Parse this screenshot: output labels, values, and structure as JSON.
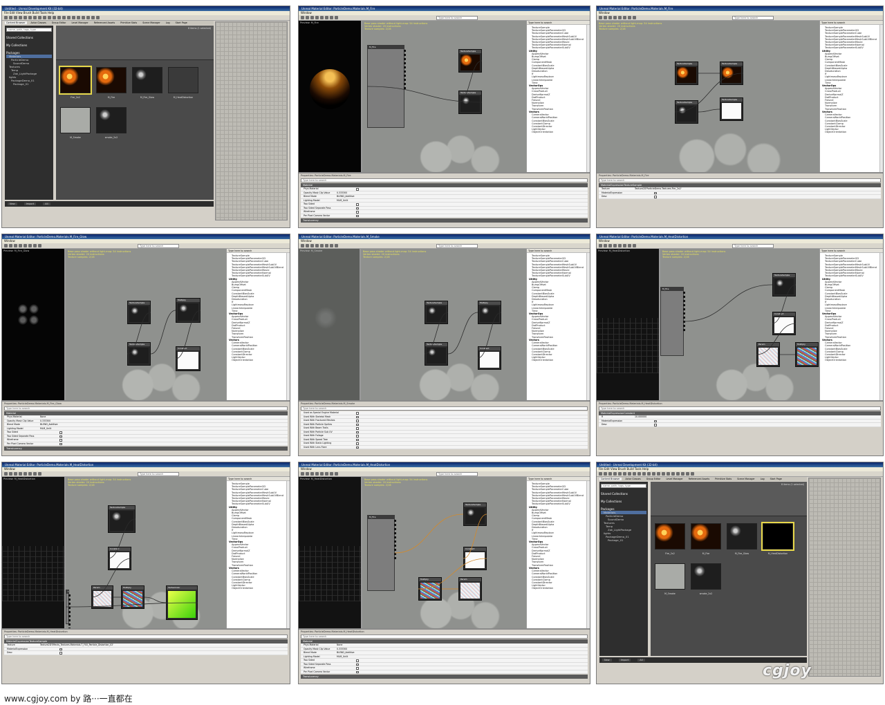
{
  "watermark": "www.cgjoy.com by 路···一直都在",
  "logo_text": "cgjoy",
  "panels": [
    {
      "kind": "content-browser",
      "title": "Untitled - Unreal Development Kit (32-bit)",
      "menu": "File  Edit  View  Brush  Build  Tools  Help",
      "tabs": [
        "Content Browser",
        "Actor Classes",
        "Group Editor",
        "Level Manager",
        "Referenced Assets",
        "Primitive Stats",
        "Scene Manager",
        "Log",
        "Start Page"
      ],
      "search_placeholder": "name, path, tags, type",
      "collections": [
        "Shared Collections",
        "My Collections",
        "Packages"
      ],
      "tree": [
        "Materials",
        "ParticleDemo",
        "SoundDemo",
        "Textures",
        "Temp",
        "Zak_LightPackage",
        "lights",
        "PackageDemo_01",
        "Package_01"
      ],
      "tiles": [
        "Fire_2x2",
        "M_Fire",
        "M_Fire_Glow",
        "M_HeatDistortion",
        "M_Smoke",
        "smoke_2x2"
      ],
      "status": "8 items (1 selected)",
      "footer": [
        "New",
        "Import",
        "All"
      ]
    },
    {
      "kind": "material-editor",
      "title": "Unreal Material Editor: ParticleDemo.Materials.M_Fire",
      "window_menu": "Window",
      "preview_label": "Preview: M_Fire",
      "search_placeholder": "Type here to search",
      "preview": "fire",
      "props_title": "Properties: ParticleDemo.Materials.M_Fire",
      "props_section": "Material",
      "props_rows": [
        [
          "Phys Material",
          ""
        ],
        [
          "Opacity Mask Clip Value",
          "0.333300"
        ],
        [
          "Blend Mode",
          "BLEND_Additive"
        ],
        [
          "Lighting Model",
          "MLM_Unlit"
        ],
        [
          "Two Sided",
          ""
        ],
        [
          "Two Sided Separate Pass",
          ""
        ],
        [
          "Wireframe",
          ""
        ],
        [
          "Per Pixel Camera Vector",
          ""
        ]
      ],
      "props_footer": "Translucency"
    },
    {
      "kind": "material-editor",
      "title": "Unreal Material Editor: ParticleDemo.Materials.M_Fire",
      "window_menu": "Window",
      "preview_label": "Preview: M_Fire",
      "search_placeholder": "Type here to search",
      "preview": "fire-small",
      "props_title": "Properties: ParticleDemo.Materials.M_Fire",
      "props_section": "MaterialExpressionTextureSample",
      "props_rows": [
        [
          "Texture",
          "Texture2D'ParticleDemo.Textures.Fire_2x2'"
        ],
        [
          "MaterialExpression",
          ""
        ],
        [
          "Desc",
          ""
        ]
      ],
      "props_footer": ""
    },
    {
      "kind": "material-editor",
      "title": "Unreal Material Editor: ParticleDemo.Materials.M_Fire_Glow",
      "window_menu": "Window",
      "preview_label": "Preview: M_Fire_Glow",
      "search_placeholder": "Type here to search",
      "preview": "smoke-dim",
      "props_title": "Properties: ParticleDemo.Materials.M_Fire_Glow",
      "props_section": "Material",
      "props_rows": [
        [
          "Phys Material",
          "None"
        ],
        [
          "Opacity Mask Clip Value",
          "0.333300"
        ],
        [
          "Blend Mode",
          "BLEND_Additive"
        ],
        [
          "Lighting Model",
          "MLM_Unlit"
        ],
        [
          "Two Sided",
          ""
        ],
        [
          "Two Sided Separate Pass",
          ""
        ],
        [
          "Wireframe",
          ""
        ],
        [
          "Per Pixel Camera Vector",
          ""
        ]
      ],
      "props_footer": "Translucency"
    },
    {
      "kind": "material-editor",
      "title": "Unreal Material Editor: ParticleDemo.Materials.M_Smoke",
      "window_menu": "Window",
      "preview_label": "Preview: M_Smoke",
      "search_placeholder": "Type here to search",
      "preview": "grey",
      "props_title": "Properties: ParticleDemo.Materials.M_Smoke",
      "props_section": "",
      "props_rows": [
        [
          "Used as Special Engine Material",
          ""
        ],
        [
          "Used With Skeletal Mesh",
          ""
        ],
        [
          "Used With Fractured Meshes",
          ""
        ],
        [
          "Used With Particle Sprites",
          ""
        ],
        [
          "Used With Beam Trails",
          ""
        ],
        [
          "Used With Particle Sub UV",
          ""
        ],
        [
          "Used With Foliage",
          ""
        ],
        [
          "Used With Speed Tree",
          ""
        ],
        [
          "Used With Static Lighting",
          ""
        ],
        [
          "Used With Lens Flare",
          ""
        ]
      ],
      "props_footer": ""
    },
    {
      "kind": "material-editor",
      "title": "Unreal Material Editor: ParticleDemo.Materials.M_HeatDistortion",
      "window_menu": "Window",
      "preview_label": "Preview: M_HeatDistortion",
      "search_placeholder": "Type here to search",
      "preview": "grid",
      "props_title": "Properties: ParticleDemo.Materials.M_HeatDistortion",
      "props_section": "MaterialExpressionConstant",
      "props_rows": [
        [
          "R",
          "10.000000"
        ],
        [
          "MaterialExpression",
          ""
        ],
        [
          "Desc",
          ""
        ]
      ],
      "props_footer": ""
    },
    {
      "kind": "material-editor",
      "title": "Unreal Material Editor: ParticleDemo.Materials.M_HeatDistortion",
      "window_menu": "Window",
      "preview_label": "Preview: M_HeatDistortion",
      "search_placeholder": "Type here to search",
      "preview": "grid",
      "props_title": "Properties: ParticleDemo.Materials.M_HeatDistortion",
      "props_section": "MaterialExpressionTextureSample",
      "props_rows": [
        [
          "Texture",
          "Texture2D'Effects_Textures.Materials.T_FX0_Particle_Distortion_02'"
        ],
        [
          "MaterialExpression",
          ""
        ],
        [
          "Desc",
          ""
        ]
      ],
      "props_footer": ""
    },
    {
      "kind": "material-editor",
      "title": "Unreal Material Editor: ParticleDemo.Materials.M_HeatDistortion",
      "window_menu": "Window",
      "preview_label": "Preview: M_HeatDistortion",
      "search_placeholder": "Type here to search",
      "preview": "grid-dark",
      "props_title": "Properties: ParticleDemo.Materials.M_HeatDistortion",
      "props_section": "Material",
      "props_rows": [
        [
          "Phys Material",
          "None"
        ],
        [
          "Opacity Mask Clip Value",
          "0.333300"
        ],
        [
          "Blend Mode",
          "BLEND_Additive"
        ],
        [
          "Lighting Model",
          "MLM_Unlit"
        ],
        [
          "Two Sided",
          ""
        ],
        [
          "Two Sided Separate Pass",
          ""
        ],
        [
          "Wireframe",
          ""
        ],
        [
          "Per Pixel Camera Vector",
          ""
        ]
      ],
      "props_footer": "Translucency"
    },
    {
      "kind": "content-browser",
      "title": "Untitled - Unreal Development Kit (32-bit)",
      "menu": "File  Edit  View  Brush  Build  Tools  Help",
      "tabs": [
        "Content Browser",
        "Actor Classes",
        "Group Editor",
        "Level Manager",
        "Referenced Assets",
        "Primitive Stats",
        "Scene Manager",
        "Log",
        "Start Page"
      ],
      "search_placeholder": "name, path, tags, type",
      "collections": [
        "Shared Collections",
        "My Collections",
        "Packages"
      ],
      "tree": [
        "Materials",
        "ParticleDemo",
        "SoundDemo",
        "Textures",
        "Temp",
        "Zak_LightPackage",
        "lights",
        "PackageDemo_01",
        "Package_01"
      ],
      "tiles": [
        "Fire_2x2",
        "M_Fire",
        "M_Fire_Glow",
        "M_HeatDistortion",
        "M_Smoke",
        "smoke_2x2"
      ],
      "status": "8 items (1 selected)",
      "footer": [
        "New",
        "Import",
        "All"
      ]
    }
  ],
  "palette": {
    "header": "Material Expressions: ParticleDemo.Materials",
    "search_placeholder": "Type here to search",
    "groups": [
      {
        "name": "",
        "items": [
          "TextureSample",
          "TextureSampleParameter2D",
          "TextureSampleParameterCube",
          "TextureSampleParameterMeshSubUV",
          "TextureSampleParameterMeshSubUVBlend",
          "TextureSampleParameterMovie",
          "TextureSampleParameterNormal",
          "TextureSampleParameterSubUV"
        ]
      },
      {
        "name": "Utility",
        "items": [
          "AppendVector",
          "BumpOffset",
          "Clamp",
          "ComponentMask",
          "ConstantBiasScale",
          "DepthBiasedAlpha",
          "Desaturation",
          "If",
          "LightmassReplace",
          "LinearInterpolate",
          "Time"
        ]
      },
      {
        "name": "VectorOps",
        "items": [
          "AppendVector",
          "CrossProduct",
          "DeriveNormalZ",
          "DotProduct",
          "Fresnel",
          "Normalize",
          "Transform",
          "TransformPosition"
        ]
      },
      {
        "name": "Vectors",
        "items": [
          "CameraVector",
          "CameraWorldPosition",
          "ConstantBiasScale",
          "ConstantClamp",
          "ConstantDirector",
          "LightVector",
          "ObjectOrientation"
        ]
      }
    ]
  },
  "node_labels": {
    "texture_sample": "TextureSample",
    "param": "Param",
    "multiply": "Multiply",
    "vertex_color": "VertexColor",
    "constant": "Constant",
    "material": "M_Fire"
  },
  "canvas_info": [
    "Base pass shader without light-map: 54 instructions",
    "Vertex shader: 20 instructions",
    "Texture samples: 2/16"
  ],
  "colors": {
    "fire": "#e56a0e",
    "canvas": "#8f918e",
    "titlebar": "#0a246a"
  }
}
